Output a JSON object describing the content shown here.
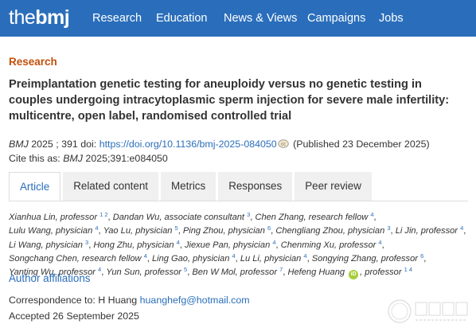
{
  "header": {
    "logo_the": "the",
    "logo_bmj": "bmj",
    "nav": [
      "Research",
      "Education",
      "News & Views",
      "Campaigns",
      "Jobs"
    ]
  },
  "article": {
    "section": "Research",
    "title": "Preimplantation genetic testing for aneuploidy versus no genetic testing in couples undergoing intracytoplasmic sperm injection for severe male infertility: multicentre, open label, randomised controlled trial",
    "journal": "BMJ",
    "year_vol": "2025 ; 391",
    "doi_label": "doi:",
    "doi_url": "https://doi.org/10.1136/bmj-2025-084050",
    "published": "(Published 23 December 2025)",
    "cite_prefix": "Cite this as:",
    "cite_journal": "BMJ",
    "cite_ref": "2025;391:e084050"
  },
  "tabs": [
    "Article",
    "Related content",
    "Metrics",
    "Responses",
    "Peer review"
  ],
  "authors": [
    {
      "name": "Xianhua Lin, professor",
      "sup": "1 2"
    },
    {
      "name": "Dandan Wu, associate consultant",
      "sup": "3"
    },
    {
      "name": "Chen Zhang, research fellow",
      "sup": "4"
    },
    {
      "name": "Lulu Wang, physician",
      "sup": "4"
    },
    {
      "name": "Yao Lu, physician",
      "sup": "5"
    },
    {
      "name": "Ping Zhou, physician",
      "sup": "6"
    },
    {
      "name": "Chengliang Zhou, physician",
      "sup": "3"
    },
    {
      "name": "Li Jin, professor",
      "sup": "4"
    },
    {
      "name": "Li Wang, physician",
      "sup": "3"
    },
    {
      "name": "Hong Zhu, physician",
      "sup": "4"
    },
    {
      "name": "Jiexue Pan, physician",
      "sup": "4"
    },
    {
      "name": "Chenming Xu, professor",
      "sup": "4"
    },
    {
      "name": "Songchang Chen, research fellow",
      "sup": "4"
    },
    {
      "name": "Ling Gao, physician",
      "sup": "4"
    },
    {
      "name": "Lu Li, physician",
      "sup": "4"
    },
    {
      "name": "Songying Zhang, professor",
      "sup": "6"
    },
    {
      "name": "Yanting Wu, professor",
      "sup": "4"
    },
    {
      "name": "Yun Sun, professor",
      "sup": "5"
    },
    {
      "name": "Ben W Mol, professor",
      "sup": "7"
    },
    {
      "name": "Hefeng Huang",
      "sup": "",
      "orcid": true,
      "suffix": ", professor",
      "suffix_sup": "1 4"
    }
  ],
  "affiliations_link": "Author affiliations",
  "correspondence_label": "Correspondence to: H Huang",
  "correspondence_email": "huanghefg@hotmail.com",
  "accepted": "Accepted 26 September 2025",
  "colors": {
    "brand": "#2a6ebb",
    "section": "#c24f0b",
    "orcid": "#a6ce39"
  },
  "icons": [
    "creative-commons-icon",
    "orcid-icon",
    "university-seal-watermark"
  ]
}
